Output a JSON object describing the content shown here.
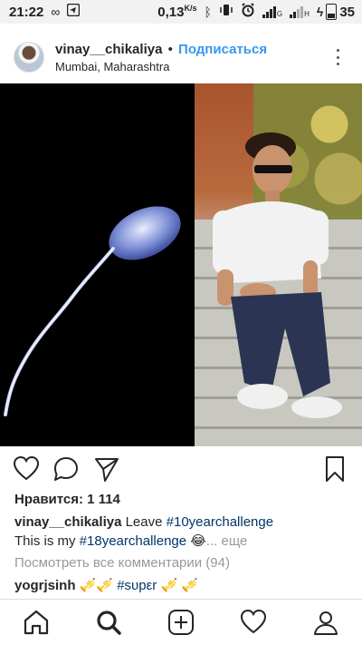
{
  "status_bar": {
    "time": "21:22",
    "left_icons": [
      "infinity-icon",
      "telegram-icon"
    ],
    "speed": "0,13",
    "speed_unit": "K/s",
    "right_icons": [
      "bluetooth-icon",
      "vibrate-icon",
      "alarm-icon",
      "signal-g-icon",
      "signal-h-icon",
      "charging-icon"
    ],
    "network_g": "G",
    "network_h": "H",
    "battery": "35"
  },
  "post": {
    "username": "vinay__chikaliya",
    "separator": "•",
    "follow_label": "Подписаться",
    "location": "Mumbai, Maharashtra",
    "likes": "Нравится: 1 114",
    "caption_user": "vinay__chikaliya",
    "caption_line1_text": "Leave",
    "caption_tag1": "#10yearchallenge",
    "caption_line2_text": "This is my",
    "caption_tag2": "#18yearchallenge",
    "caption_emoji": "😂",
    "caption_more": "... еще",
    "view_comments": "Посмотреть все комментарии (94)",
    "comment_user": "yogrjsinh",
    "comment_text_pre": "🎺🎺",
    "comment_tag": "#sυpεr",
    "comment_text_post": "🎺 🎺"
  },
  "nav": {
    "items": [
      "home-icon",
      "search-icon",
      "new-post-icon",
      "activity-icon",
      "profile-icon"
    ]
  },
  "colors": {
    "link_blue": "#3897f0",
    "hashtag": "#003569",
    "muted": "#999999",
    "status_bg": "#f2f2f2"
  }
}
